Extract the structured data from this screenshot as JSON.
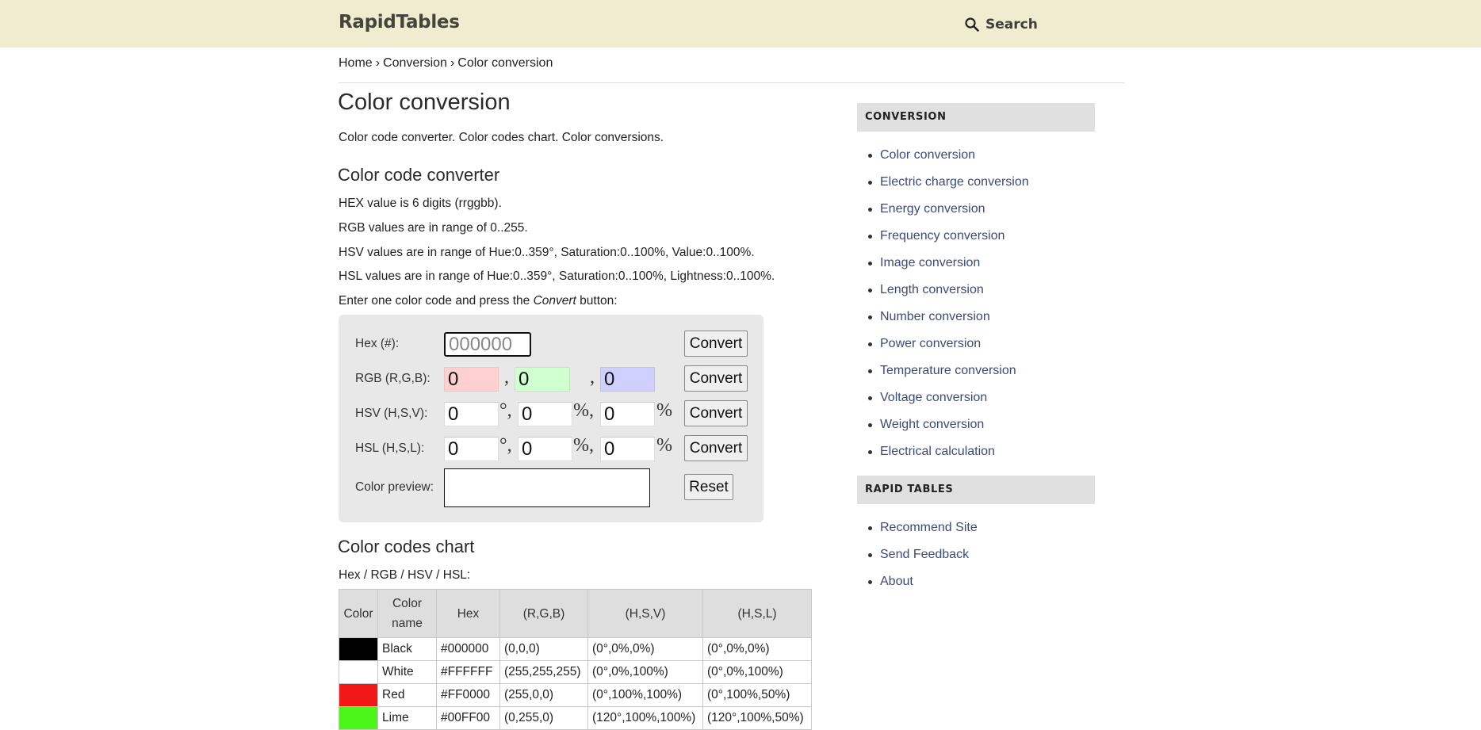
{
  "header": {
    "logo": "RapidTables",
    "search_label": "Search",
    "search_icon": "search-icon"
  },
  "breadcrumb": {
    "items": [
      "Home",
      "Conversion",
      "Color conversion"
    ],
    "separator": "›"
  },
  "page": {
    "title": "Color conversion",
    "intro": "Color code converter. Color codes chart. Color conversions."
  },
  "converter": {
    "heading": "Color code converter",
    "notes": [
      "HEX value is 6 digits (rrggbb).",
      "RGB values are in range of 0..255.",
      "HSV values are in range of Hue:0..359°, Saturation:0..100%, Value:0..100%.",
      "HSL values are in range of Hue:0..359°, Saturation:0..100%, Lightness:0..100%."
    ],
    "instruction_pre": "Enter one color code and press the ",
    "instruction_em": "Convert",
    "instruction_post": " button:",
    "hex": {
      "label": "Hex (#):",
      "value": "",
      "placeholder": "000000"
    },
    "rgb": {
      "label": "RGB (R,G,B):",
      "r": "0",
      "g": "0",
      "b": "0",
      "sep": ","
    },
    "hsv": {
      "label": "HSV (H,S,V):",
      "h": "0",
      "s": "0",
      "v": "0",
      "deg": "°,",
      "pct_comma": "%,",
      "pct": "%"
    },
    "hsl": {
      "label": "HSL (H,S,L):",
      "h": "0",
      "s": "0",
      "l": "0",
      "deg": "°,",
      "pct_comma": "%,",
      "pct": "%"
    },
    "preview_label": "Color preview:",
    "preview_color": "#FFFFFF",
    "convert_label": "Convert",
    "reset_label": "Reset",
    "colors": {
      "r_bg": "#ffd0d0",
      "g_bg": "#d0ffd0",
      "b_bg": "#d0d0ff",
      "panel_bg": "#e8e8e8"
    }
  },
  "chart": {
    "heading": "Color codes chart",
    "subtitle": "Hex / RGB / HSV / HSL:",
    "columns": [
      "Color",
      "Color\nname",
      "Hex",
      "(R,G,B)",
      "(H,S,V)",
      "(H,S,L)"
    ],
    "column_name_line1": "Color",
    "column_name_line2": "name",
    "rows": [
      {
        "swatch": "#000000",
        "name": "Black",
        "hex": "#000000",
        "rgb": "(0,0,0)",
        "hsv": "(0°,0%,0%)",
        "hsl": "(0°,0%,0%)"
      },
      {
        "swatch": "#FFFFFF",
        "name": "White",
        "hex": "#FFFFFF",
        "rgb": "(255,255,255)",
        "hsv": "(0°,0%,100%)",
        "hsl": "(0°,0%,100%)"
      },
      {
        "swatch": "#F21818",
        "name": "Red",
        "hex": "#FF0000",
        "rgb": "(255,0,0)",
        "hsv": "(0°,100%,100%)",
        "hsl": "(0°,100%,50%)"
      },
      {
        "swatch": "#4CF51A",
        "name": "Lime",
        "hex": "#00FF00",
        "rgb": "(0,255,0)",
        "hsv": "(120°,100%,100%)",
        "hsl": "(120°,100%,50%)"
      }
    ]
  },
  "sidebar": {
    "sections": [
      {
        "title": "CONVERSION",
        "items": [
          "Color conversion",
          "Electric charge conversion",
          "Energy conversion",
          "Frequency conversion",
          "Image conversion",
          "Length conversion",
          "Number conversion",
          "Power conversion",
          "Temperature conversion",
          "Voltage conversion",
          "Weight conversion",
          "Electrical calculation"
        ]
      },
      {
        "title": "RAPID TABLES",
        "items": [
          "Recommend Site",
          "Send Feedback",
          "About"
        ]
      }
    ],
    "link_color": "#3b4a78"
  },
  "theme": {
    "header_bg": "#f0ecd0"
  }
}
